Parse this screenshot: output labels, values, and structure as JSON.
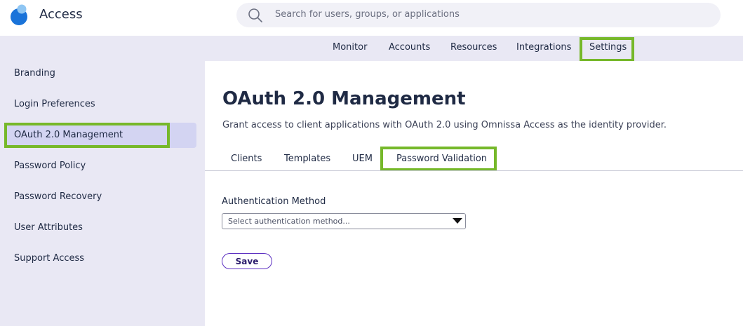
{
  "app": {
    "title": "Access",
    "search_placeholder": "Search for users, groups, or applications"
  },
  "nav": {
    "items": [
      {
        "label": "Monitor"
      },
      {
        "label": "Accounts"
      },
      {
        "label": "Resources"
      },
      {
        "label": "Integrations"
      },
      {
        "label": "Settings",
        "highlighted": true
      }
    ]
  },
  "sidebar": {
    "items": [
      {
        "label": "Branding"
      },
      {
        "label": "Login Preferences"
      },
      {
        "label": "OAuth 2.0 Management",
        "active": true
      },
      {
        "label": "Password Policy"
      },
      {
        "label": "Password Recovery"
      },
      {
        "label": "User Attributes"
      },
      {
        "label": "Support Access"
      }
    ]
  },
  "main": {
    "title": "OAuth 2.0 Management",
    "description": "Grant access to client applications with OAuth 2.0 using Omnissa Access as the identity provider.",
    "tabs": [
      {
        "label": "Clients"
      },
      {
        "label": "Templates"
      },
      {
        "label": "UEM"
      },
      {
        "label": "Password Validation",
        "active": true
      }
    ],
    "form": {
      "auth_method_label": "Authentication Method",
      "auth_method_placeholder": "Select authentication method...",
      "save_label": "Save"
    }
  },
  "colors": {
    "highlight": "#76b82a",
    "accent": "#5b2ec1",
    "band": "#e9e8f4"
  }
}
